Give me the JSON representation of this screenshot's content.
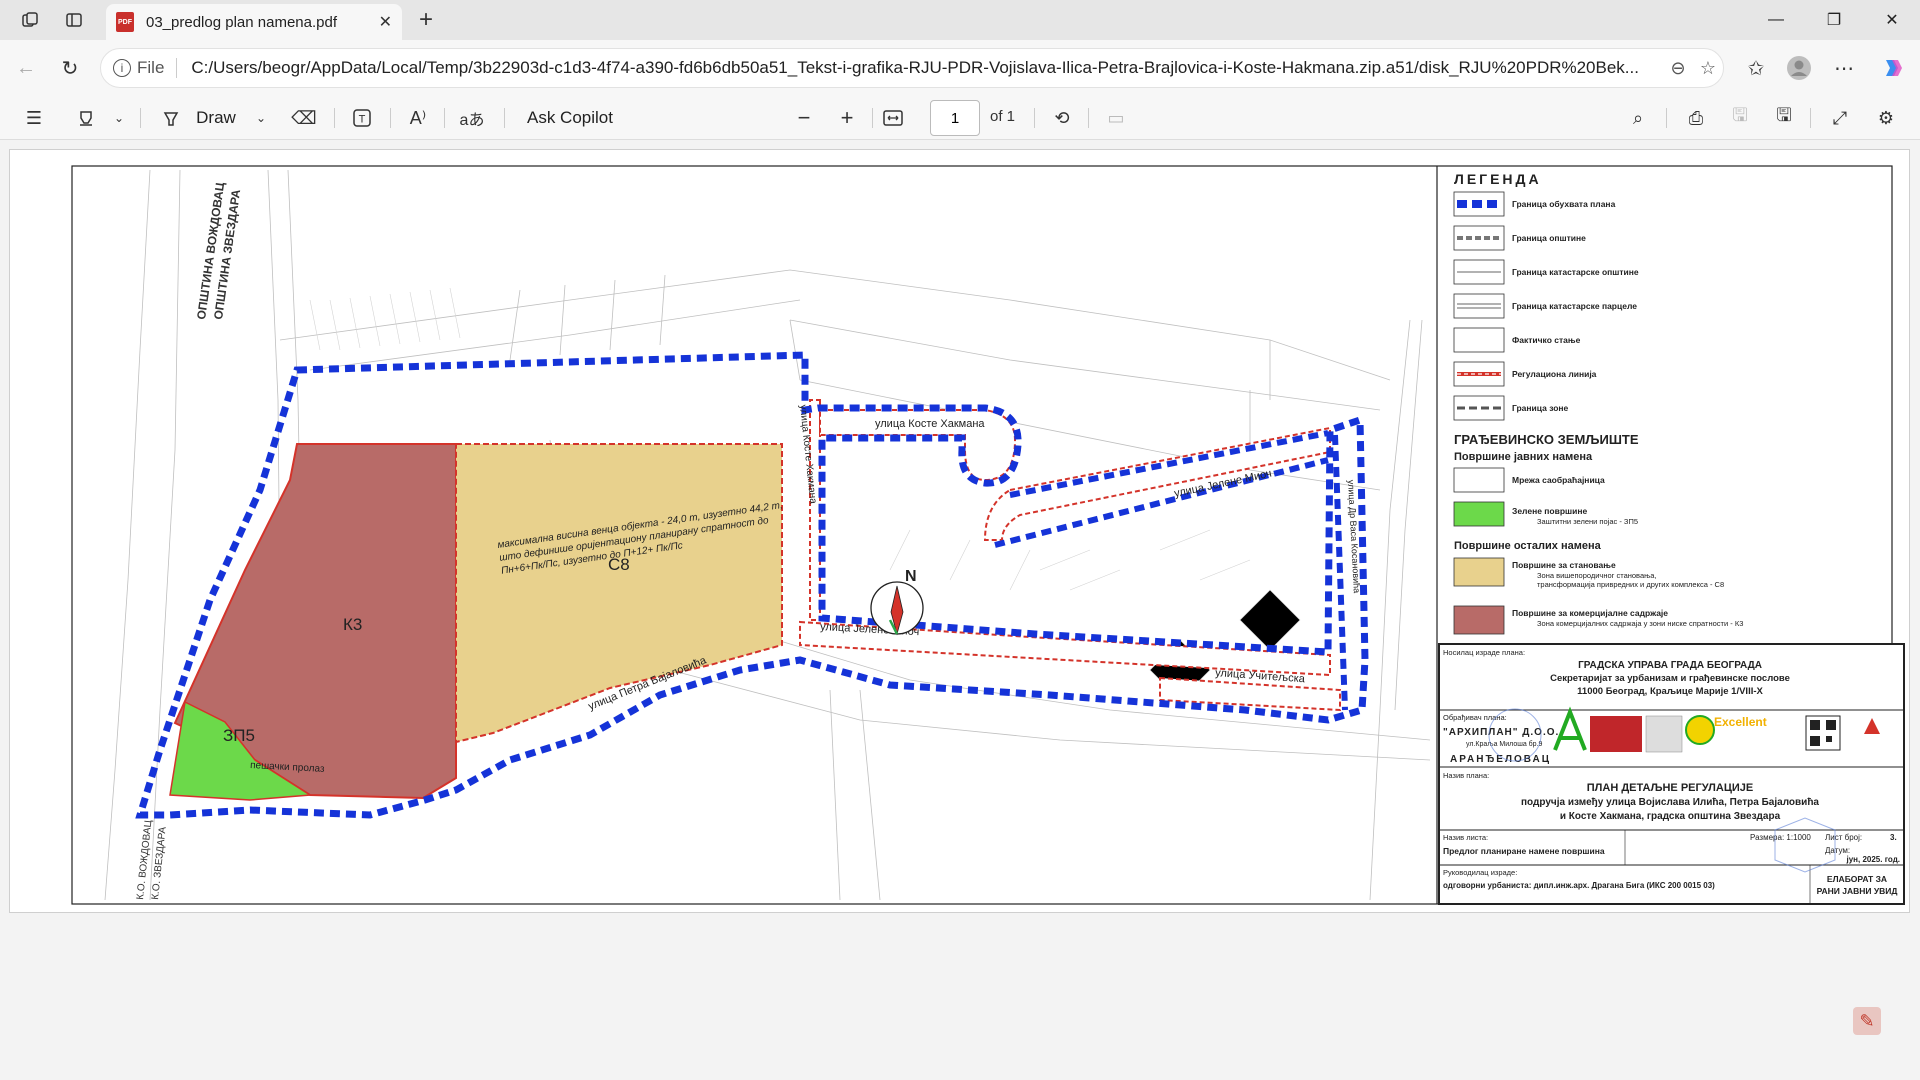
{
  "browser": {
    "tab_title": "03_predlog plan namena.pdf",
    "tab_icon": "pdf-file-icon",
    "url_scheme_label": "File",
    "url": "C:/Users/beogr/AppData/Local/Temp/3b22903d-c1d3-4f74-a390-fd6b6db50a51_Tekst-i-grafika-RJU-PDR-Vojislava-Ilica-Petra-Brajlovica-i-Koste-Hakmana.zip.a51/disk_RJU%20PDR%20Bek..."
  },
  "pdf_toolbar": {
    "draw_label": "Draw",
    "ask_copilot_label": "Ask Copilot",
    "page_number": "1",
    "page_count": "of 1"
  },
  "map": {
    "municipality_labels": [
      "ОПШТИНА ВОЖДОВАЦ",
      "ОПШТИНА ЗВЕЗДАРА"
    ],
    "cadastral_labels": [
      "К.О. ВОЖДОВАЦ",
      "К.О. ЗВЕЗДАРА"
    ],
    "zones": {
      "k3": "К3",
      "c8": "С8",
      "zp5": "ЗП5"
    },
    "c8_note_lines": [
      "максимална висина венца објекта - 24,0 m, изузетно 44,2 m,",
      "што дефинише оријентациону планирану спратност до",
      "Пн+6+Пк/Пс, изузетно до П+12+ Пк/Пс"
    ],
    "streets": {
      "koste_hakmana": "улица Косте Хакмана",
      "koste_hakmana_vertical": "улица Косте Хакмана",
      "jelene_mioc_upper": "улица Јелене Миоч",
      "jelene_mioc_lower": "улица Јелене Миоч",
      "petra_bajalovica": "улица Петра Бајаловића",
      "uciteljska": "улица Учитељска",
      "dr_vasilija": "улица Др Васа Косановића",
      "pesacki_prolaz": "пешачки пролаз"
    },
    "north_label": "N"
  },
  "legend": {
    "title": "ЛЕГЕНДА",
    "items": [
      {
        "label": "Граница обухвата плана",
        "style": "blue-dashed"
      },
      {
        "label": "Граница општине",
        "style": "grey-dashed"
      },
      {
        "label": "Граница катастарске општине",
        "style": "thin-line"
      },
      {
        "label": "Граница катастарске парцеле",
        "style": "double-line"
      },
      {
        "label": "Фактичко стање",
        "style": "thin-line"
      },
      {
        "label": "Регулациона линија",
        "style": "red-dashed"
      },
      {
        "label": "Граница зоне",
        "style": "dark-dashed"
      }
    ],
    "section_title": "ГРАЂЕВИНСКО ЗЕМЉИШТЕ",
    "public_title": "Површине јавних намена",
    "public_items": [
      {
        "label": "Мрежа саобраћајница",
        "sublabel": "",
        "color": "#ffffff"
      },
      {
        "label": "Зелене површине",
        "sublabel": "Заштитни зелени појас - ЗП5",
        "color": "#6cd94a"
      }
    ],
    "other_title": "Површине осталих намена",
    "other_items": [
      {
        "label": "Површине за становање",
        "sublabel_1": "Зона вишепородичног становања,",
        "sublabel_2": "трансформација привредних и других комплекса - С8",
        "color": "#e8d18d"
      },
      {
        "label": "Површине за комерцијалне садржаје",
        "sublabel_1": "Зона комерцијалних садржаја у зони ниске спратности - К3",
        "sublabel_2": "",
        "color": "#b86b68"
      }
    ]
  },
  "title_block": {
    "holder_label": "Носилац израде плана:",
    "holder_line1": "ГРАДСКА УПРАВА ГРАДА БЕОГРАДА",
    "holder_line2": "Секретаријат за урбанизам и грађевинске послове",
    "holder_line3": "11000 Београд, Краљице Марије 1/VIII-X",
    "maker_label": "Обрађивач плана:",
    "maker_name": "\"АРХИПЛАН\" Д.О.О.",
    "maker_address": "ул.Краља Милоша бр.9",
    "maker_city": "АРАНЂЕЛОВАЦ",
    "excellent_label": "Excellent",
    "plan_name_label": "Назив плана:",
    "plan_name_1": "ПЛАН ДЕТАЉНЕ РЕГУЛАЦИЈЕ",
    "plan_name_2": "подручја између улица Војислава Илића, Петра Бајаловића",
    "plan_name_3": "и Косте Хакмана, градска општина Звездара",
    "sheet_label": "Назив листа:",
    "sheet_name": "Предлог планиране намене површина",
    "scale_label": "Размера: 1:1000",
    "sheet_no_label": "Лист број:",
    "sheet_no": "3.",
    "date_label": "Датум:",
    "date_value": "јун, 2025. год.",
    "leader_label": "Руководилац израде:",
    "leader_name": "одговорни урбаниста: дипл.инж.арх. Драгана Бига (ИКС 200 0015 03)",
    "phase_1": "ЕЛАБОРАТ ЗА",
    "phase_2": "РАНИ ЈАВНИ УВИД"
  },
  "colors": {
    "plan_boundary": "#1533d8",
    "regulation_line": "#d4332a",
    "commercial_k3": "#b86b68",
    "residential_c8": "#e8d18d",
    "green_zp5": "#6cd94a"
  }
}
